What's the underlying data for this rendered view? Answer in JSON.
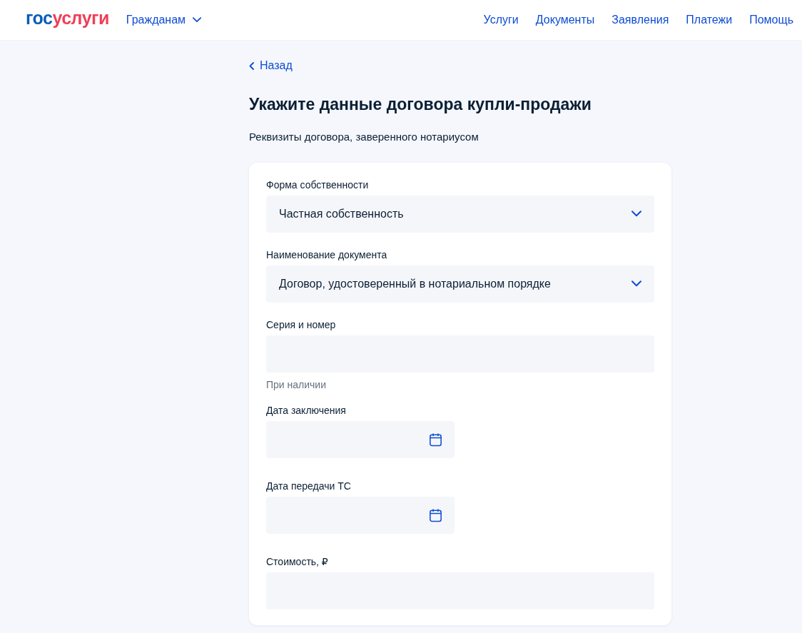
{
  "header": {
    "logo": {
      "part_1": "гос",
      "part_2": "услуги"
    },
    "audience_menu": "Гражданам",
    "nav": [
      "Услуги",
      "Документы",
      "Заявления",
      "Платежи",
      "Помощь"
    ]
  },
  "back_link": "Назад",
  "title": "Укажите данные договора купли-продажи",
  "subtitle": "Реквизиты договора, заверенного нотариусом",
  "fields": [
    {
      "kind": "select",
      "label": "Форма собственности",
      "value": "Частная собственность"
    },
    {
      "kind": "select",
      "label": "Наименование документа",
      "value": "Договор, удостоверенный в нотариальном порядке"
    },
    {
      "kind": "text",
      "label": "Серия и номер",
      "hint": "При наличии"
    },
    {
      "kind": "date",
      "label": "Дата заключения"
    },
    {
      "kind": "date",
      "label": "Дата передачи ТС"
    },
    {
      "kind": "text",
      "label": "Стоимость, ₽"
    }
  ]
}
